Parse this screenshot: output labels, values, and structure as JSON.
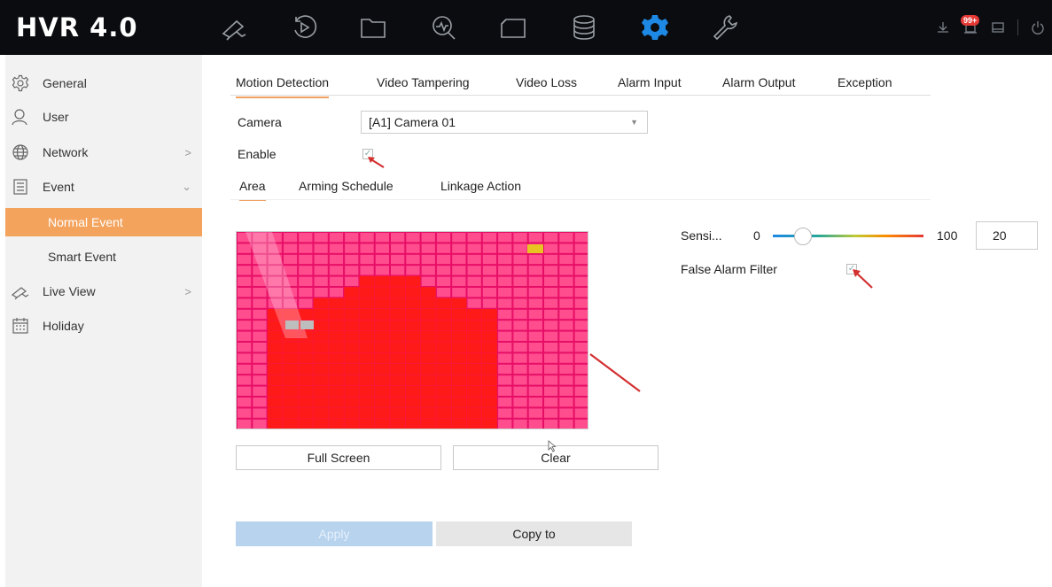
{
  "app": {
    "logo": "HVR 4.0"
  },
  "topbar": {
    "nav_icons": [
      "live-view-icon",
      "playback-icon",
      "file-management-icon",
      "smart-search-icon",
      "manual-icon",
      "storage-icon",
      "configuration-icon",
      "maintenance-icon"
    ],
    "active_icon": "configuration-icon",
    "notification_count": "99+",
    "right_icons": [
      "download-icon",
      "alarm-icon",
      "lock-icon",
      "power-icon"
    ]
  },
  "sidebar": {
    "items": [
      {
        "label": "General",
        "icon": "gear-icon"
      },
      {
        "label": "User",
        "icon": "user-icon"
      },
      {
        "label": "Network",
        "icon": "globe-icon",
        "chevron": ">"
      },
      {
        "label": "Event",
        "icon": "event-icon",
        "chevron": "⌄"
      },
      {
        "label": "Normal Event"
      },
      {
        "label": "Smart Event"
      },
      {
        "label": "Live View",
        "icon": "camera-icon",
        "chevron": ">"
      },
      {
        "label": "Holiday",
        "icon": "calendar-icon"
      }
    ],
    "active": "Normal Event"
  },
  "tabs": [
    "Motion Detection",
    "Video Tampering",
    "Video Loss",
    "Alarm Input",
    "Alarm Output",
    "Exception"
  ],
  "active_tab": "Motion Detection",
  "form": {
    "camera_label": "Camera",
    "camera_value": "[A1] Camera 01",
    "enable_label": "Enable",
    "enable_checked": true
  },
  "subtabs": [
    "Area",
    "Arming Schedule",
    "Linkage Action"
  ],
  "active_subtab": "Area",
  "sensitivity": {
    "label": "Sensi...",
    "min": "0",
    "max": "100",
    "value": "20",
    "slider_level": 0.2
  },
  "false_alarm": {
    "label": "False Alarm Filter",
    "checked": true
  },
  "buttons": {
    "full_screen": "Full Screen",
    "clear": "Clear",
    "apply": "Apply",
    "copy_to": "Copy to"
  },
  "colors": {
    "accent": "#f4a35d",
    "motion_area": "#f0135a",
    "apply_bg": "#b7d3ee",
    "topbar": "#0b0c10",
    "active_icon": "#1e88e5"
  }
}
